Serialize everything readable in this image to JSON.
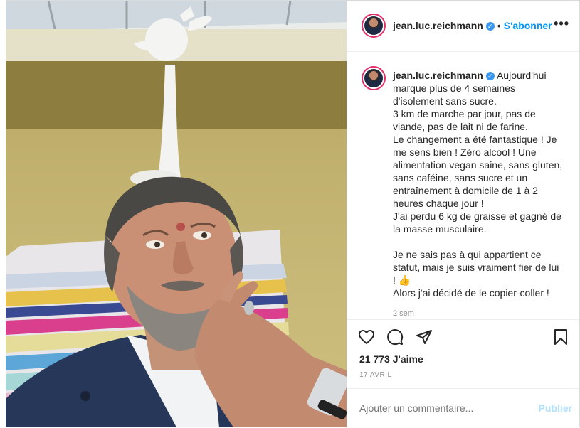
{
  "post": {
    "username": "jean.luc.reichmann",
    "verified_symbol": "✓",
    "separator": "•",
    "follow_label": "S'abonner",
    "more_label": "•••",
    "caption_lines": [
      "Aujourd'hui",
      "marque plus de 4 semaines",
      "d'isolement sans sucre.",
      "3 km de marche par jour, pas de",
      "viande, pas de lait ni de farine.",
      "Le changement a été fantastique ! Je",
      "me sens bien ! Zéro alcool ! Une",
      "alimentation vegan saine, sans gluten,",
      "sans caféine, sans sucre et un",
      "entraînement à domicile de 1 à 2",
      "heures chaque jour !",
      "J'ai perdu 6 kg de graisse et gagné de",
      "la masse musculaire.",
      "",
      "Je ne sais pas à qui appartient ce",
      "statut, mais je suis vraiment fier de lui",
      "! 👍",
      "Alors j'ai décidé de le copier-coller !"
    ],
    "caption_time": "2 sem",
    "likes": "21 773 J'aime",
    "date": "17 AVRIL",
    "comment_placeholder": "Ajouter un commentaire...",
    "publish_label": "Publier",
    "icons": [
      "heart-icon",
      "comment-icon",
      "share-icon",
      "bookmark-icon"
    ],
    "colors": {
      "accent": "#0095f6",
      "verified": "#3897f0",
      "publish_disabled": "#b2dffc"
    }
  }
}
